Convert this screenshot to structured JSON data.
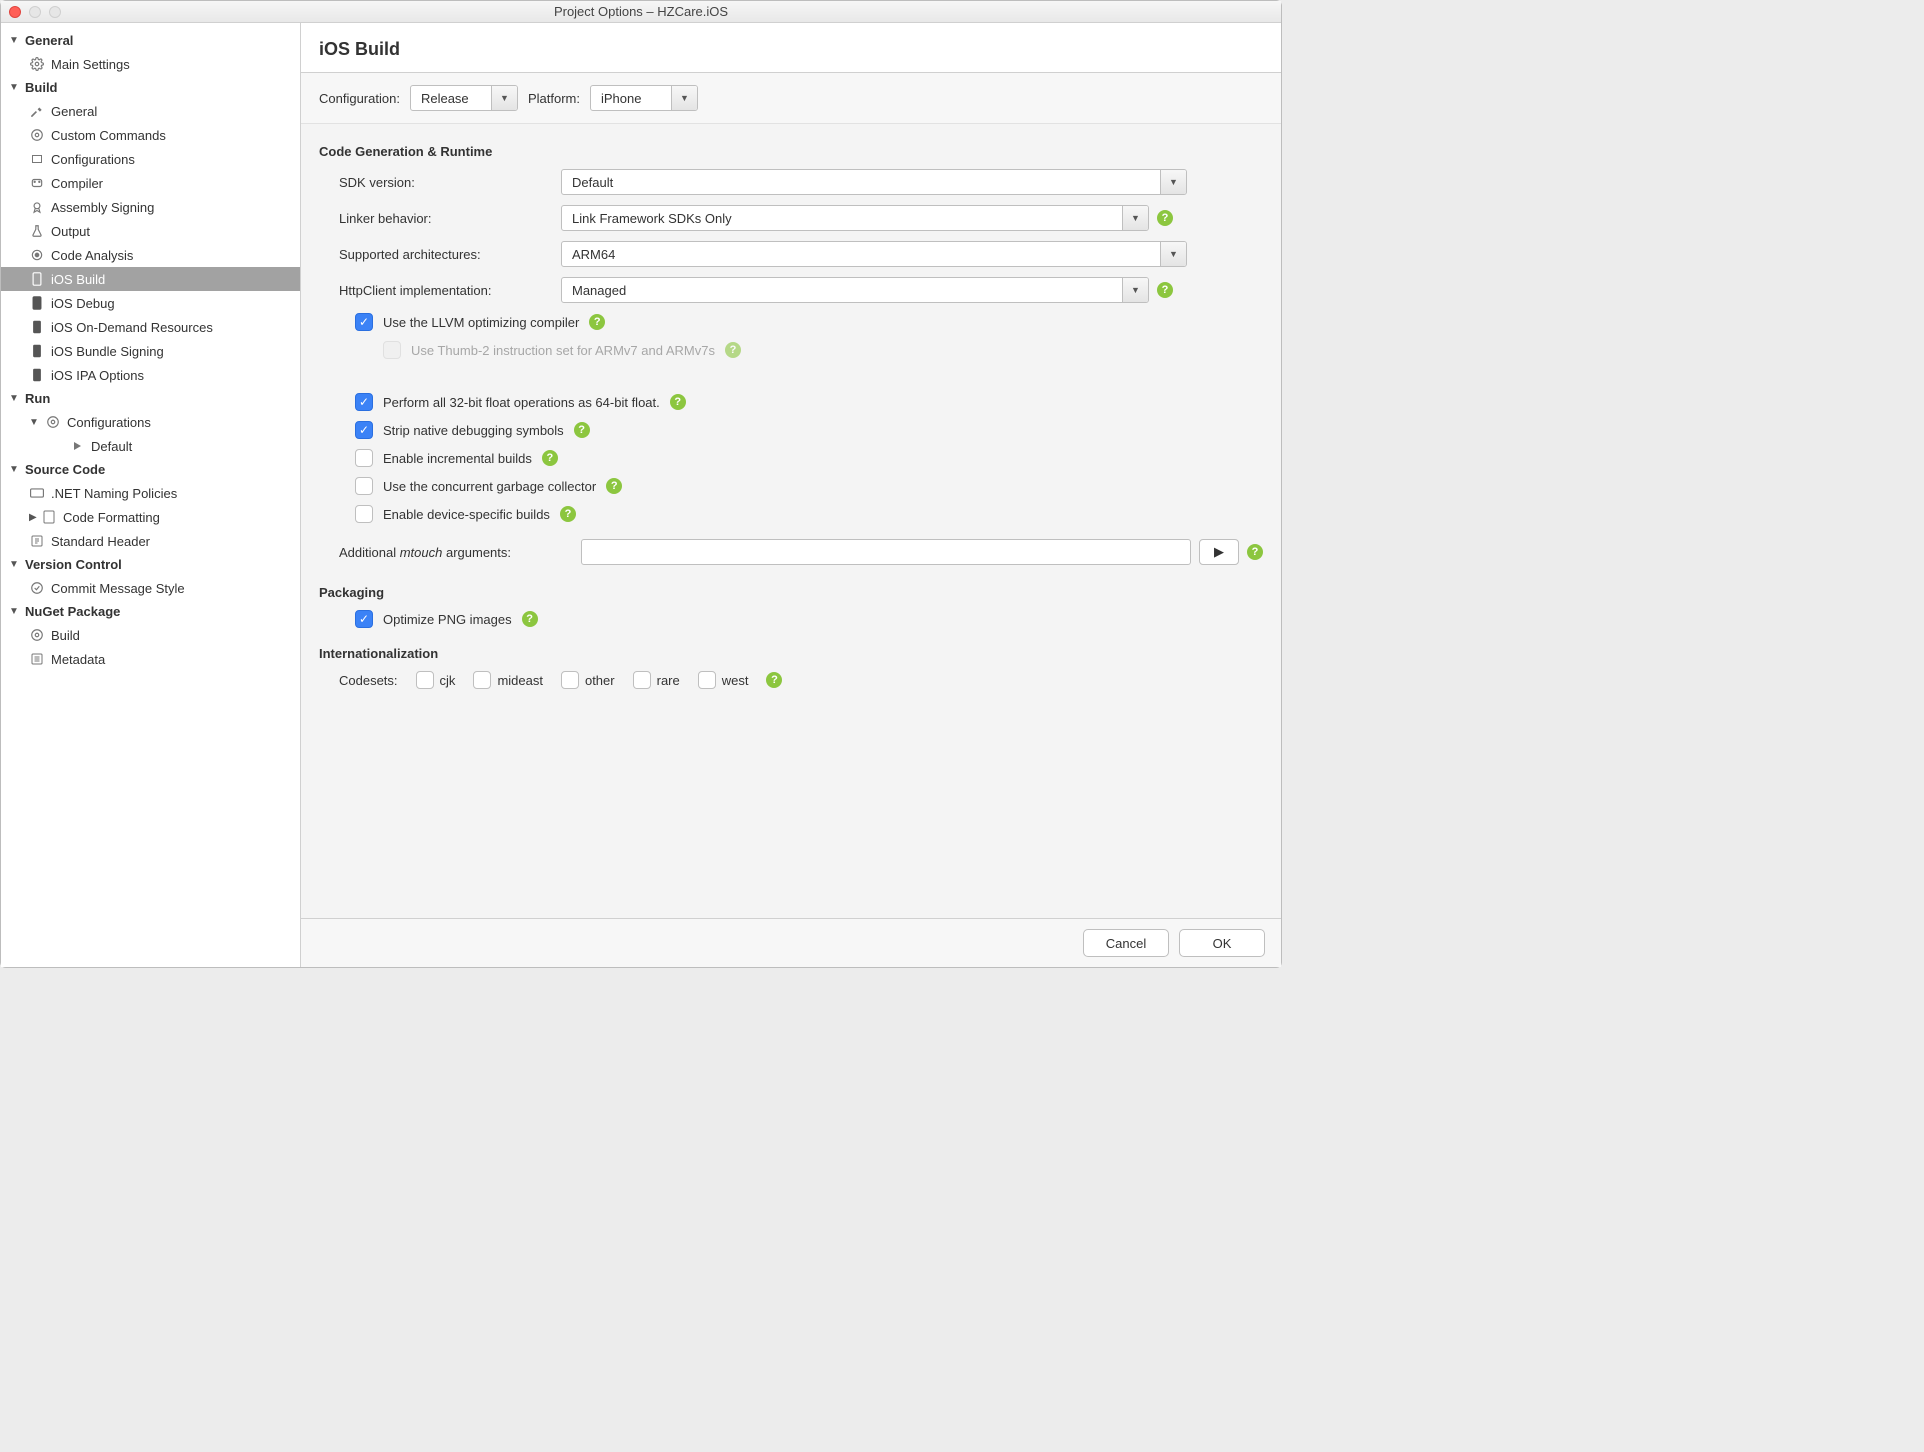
{
  "window": {
    "title": "Project Options – HZCare.iOS"
  },
  "sidebar": {
    "general": {
      "label": "General",
      "main_settings": "Main Settings"
    },
    "build": {
      "label": "Build",
      "general": "General",
      "custom_commands": "Custom Commands",
      "configurations": "Configurations",
      "compiler": "Compiler",
      "assembly_signing": "Assembly Signing",
      "output": "Output",
      "code_analysis": "Code Analysis",
      "ios_build": "iOS Build",
      "ios_debug": "iOS Debug",
      "ios_ondemand": "iOS On-Demand Resources",
      "ios_bundle_signing": "iOS Bundle Signing",
      "ios_ipa_options": "iOS IPA Options"
    },
    "run": {
      "label": "Run",
      "configurations": "Configurations",
      "default": "Default"
    },
    "source_code": {
      "label": "Source Code",
      "naming": ".NET Naming Policies",
      "formatting": "Code Formatting",
      "header": "Standard Header"
    },
    "version_control": {
      "label": "Version Control",
      "commit_style": "Commit Message Style"
    },
    "nuget": {
      "label": "NuGet Package",
      "build": "Build",
      "metadata": "Metadata"
    }
  },
  "page": {
    "title": "iOS Build",
    "config_label": "Configuration:",
    "config_value": "Release",
    "platform_label": "Platform:",
    "platform_value": "iPhone",
    "cg_title": "Code Generation & Runtime",
    "sdk_label": "SDK version:",
    "sdk_value": "Default",
    "linker_label": "Linker behavior:",
    "linker_value": "Link Framework SDKs Only",
    "arch_label": "Supported architectures:",
    "arch_value": "ARM64",
    "http_label": "HttpClient implementation:",
    "http_value": "Managed",
    "llvm": "Use the LLVM optimizing compiler",
    "thumb2": "Use Thumb-2 instruction set for ARMv7 and ARMv7s",
    "float64": "Perform all 32-bit float operations as 64-bit float.",
    "strip": "Strip native debugging symbols",
    "incremental": "Enable incremental builds",
    "gc": "Use the concurrent garbage collector",
    "device_builds": "Enable device-specific builds",
    "mtouch_label_a": "Additional ",
    "mtouch_label_b": "mtouch",
    "mtouch_label_c": " arguments:",
    "packaging_title": "Packaging",
    "optimize_png": "Optimize PNG images",
    "i18n_title": "Internationalization",
    "codesets_label": "Codesets:",
    "cs": {
      "cjk": "cjk",
      "mideast": "mideast",
      "other": "other",
      "rare": "rare",
      "west": "west"
    }
  },
  "footer": {
    "cancel": "Cancel",
    "ok": "OK"
  }
}
